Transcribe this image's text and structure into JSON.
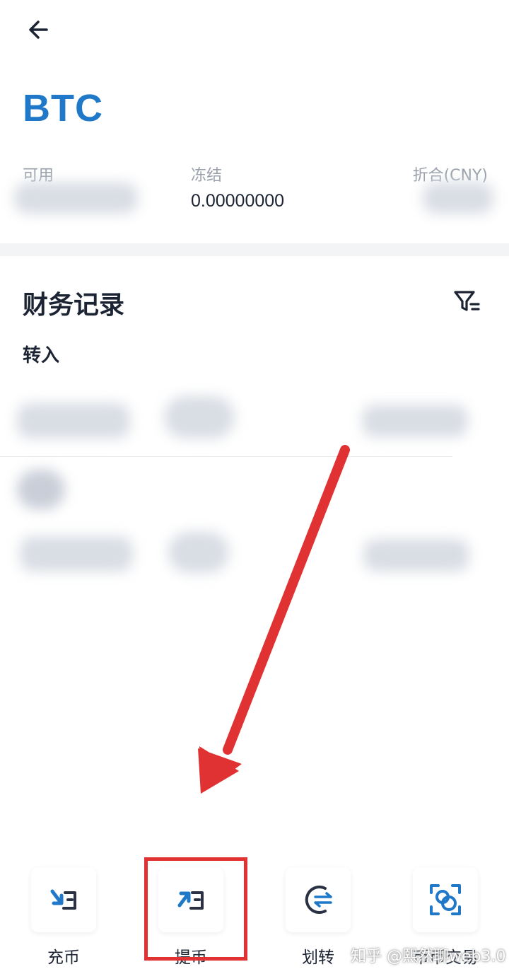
{
  "header": {
    "coin": "BTC",
    "back_icon": "arrow-left-icon"
  },
  "balance": {
    "available_label": "可用",
    "frozen_label": "冻结",
    "frozen_value": "0.00000000",
    "cny_label": "折合(CNY)"
  },
  "records": {
    "title": "财务记录",
    "filter_icon": "filter-icon",
    "tab_label": "转入"
  },
  "actions": [
    {
      "label": "充币",
      "icon": "deposit-icon"
    },
    {
      "label": "提币",
      "icon": "withdraw-icon"
    },
    {
      "label": "划转",
      "icon": "transfer-icon"
    },
    {
      "label": "币币交易",
      "icon": "trade-icon"
    }
  ],
  "watermark": "知乎 @熙然聊web3.0",
  "colors": {
    "accent": "#1f78c8",
    "highlight": "#e03232",
    "icon_dark": "#2a3142"
  }
}
